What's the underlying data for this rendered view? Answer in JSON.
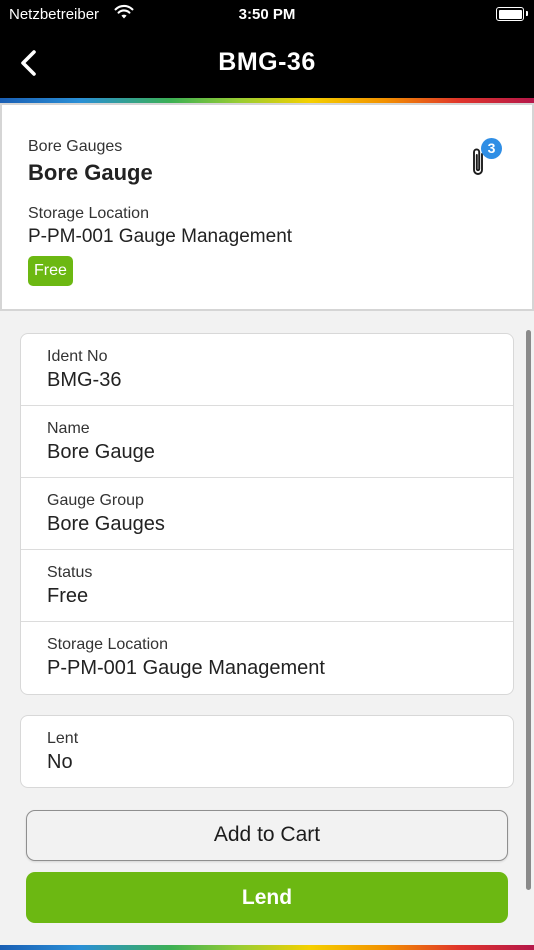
{
  "status_bar": {
    "carrier": "Netzbetreiber",
    "time": "3:50 PM"
  },
  "nav": {
    "title": "BMG-36"
  },
  "header": {
    "group": "Bore Gauges",
    "name": "Bore Gauge",
    "storage_label": "Storage Location",
    "storage_value": "P-PM-001 Gauge Management",
    "status_badge": "Free",
    "attachment_count": "3"
  },
  "details": [
    {
      "label": "Ident No",
      "value": "BMG-36"
    },
    {
      "label": "Name",
      "value": "Bore Gauge"
    },
    {
      "label": "Gauge Group",
      "value": "Bore Gauges"
    },
    {
      "label": "Status",
      "value": "Free"
    },
    {
      "label": "Storage Location",
      "value": "P-PM-001 Gauge Management"
    }
  ],
  "lent": {
    "label": "Lent",
    "value": "No"
  },
  "actions": {
    "add_to_cart": "Add to Cart",
    "lend": "Lend"
  },
  "colors": {
    "accent_green": "#6cb812",
    "badge_blue": "#2f8ee5",
    "nav_bg": "#000000"
  },
  "icons": [
    "wifi-icon",
    "battery-icon",
    "back-chevron-icon",
    "paperclip-icon"
  ]
}
